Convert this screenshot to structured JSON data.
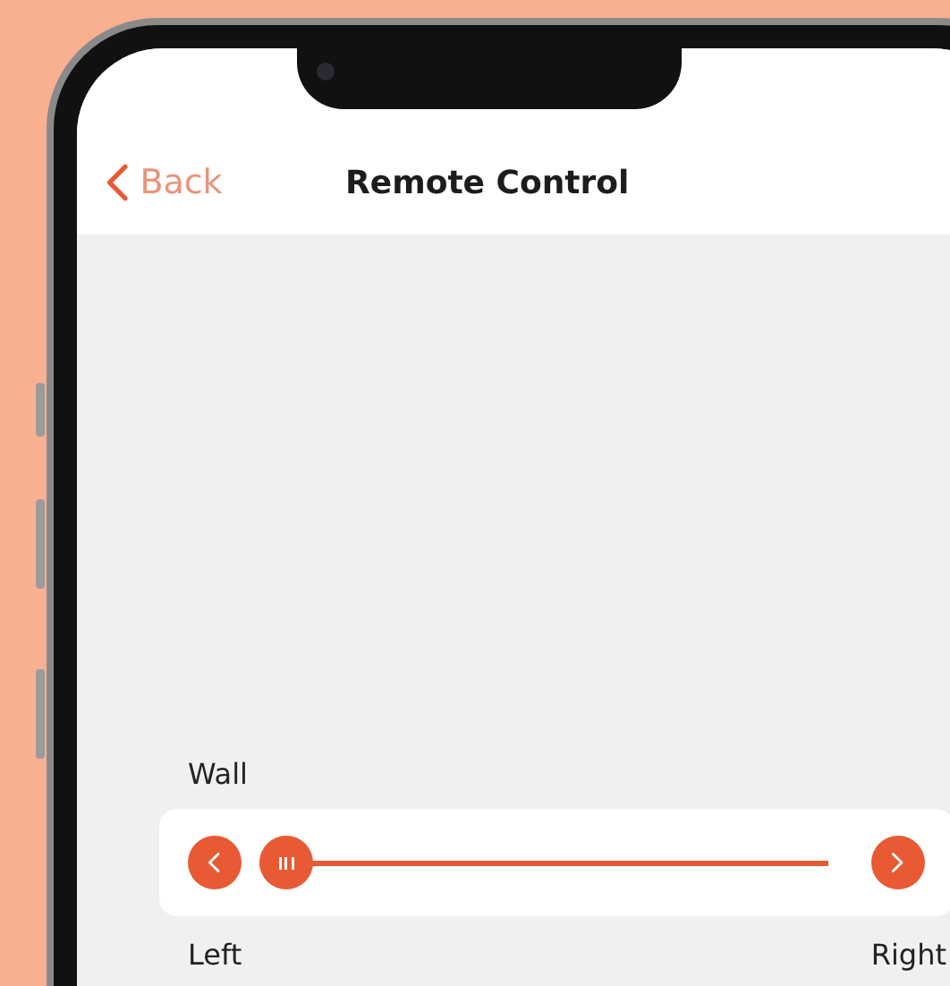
{
  "header": {
    "back": "Back",
    "title": "Remote Control"
  },
  "control": {
    "label": "Wall",
    "level": 0,
    "left_label": "Left",
    "right_label": "Right"
  }
}
